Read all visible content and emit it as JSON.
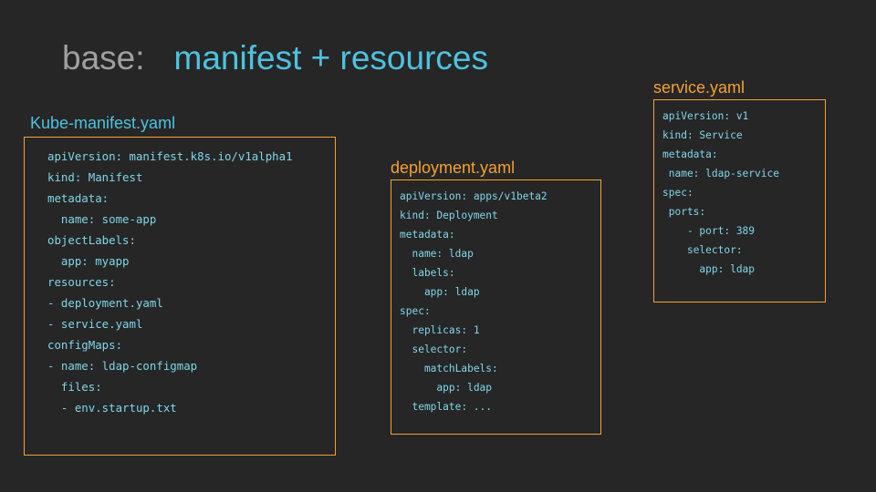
{
  "title": {
    "prefix": "base:",
    "main": "manifest + resources"
  },
  "files": [
    {
      "label": "Kube-manifest.yaml",
      "lines": [
        "apiVersion: manifest.k8s.io/v1alpha1",
        "kind: Manifest",
        "metadata:",
        "  name: some-app",
        "objectLabels:",
        "  app: myapp",
        "resources:",
        "- deployment.yaml",
        "- service.yaml",
        "configMaps:",
        "- name: ldap-configmap",
        "  files:",
        "  - env.startup.txt"
      ]
    },
    {
      "label": "deployment.yaml",
      "lines": [
        "apiVersion: apps/v1beta2",
        "kind: Deployment",
        "metadata:",
        "  name: ldap",
        "  labels:",
        "    app: ldap",
        "spec:",
        "  replicas: 1",
        "  selector:",
        "    matchLabels:",
        "      app: ldap",
        "  template: ..."
      ]
    },
    {
      "label": "service.yaml",
      "lines": [
        "apiVersion: v1",
        "kind: Service",
        "metadata:",
        " name: ldap-service",
        "spec:",
        " ports:",
        "    - port: 389",
        "    selector:",
        "      app: ldap"
      ]
    }
  ],
  "colors": {
    "background": "#262626",
    "title_prefix": "#a0a0a0",
    "accent_cyan": "#4dc2df",
    "accent_orange": "#f5a033",
    "code_text": "#80d6e9"
  }
}
